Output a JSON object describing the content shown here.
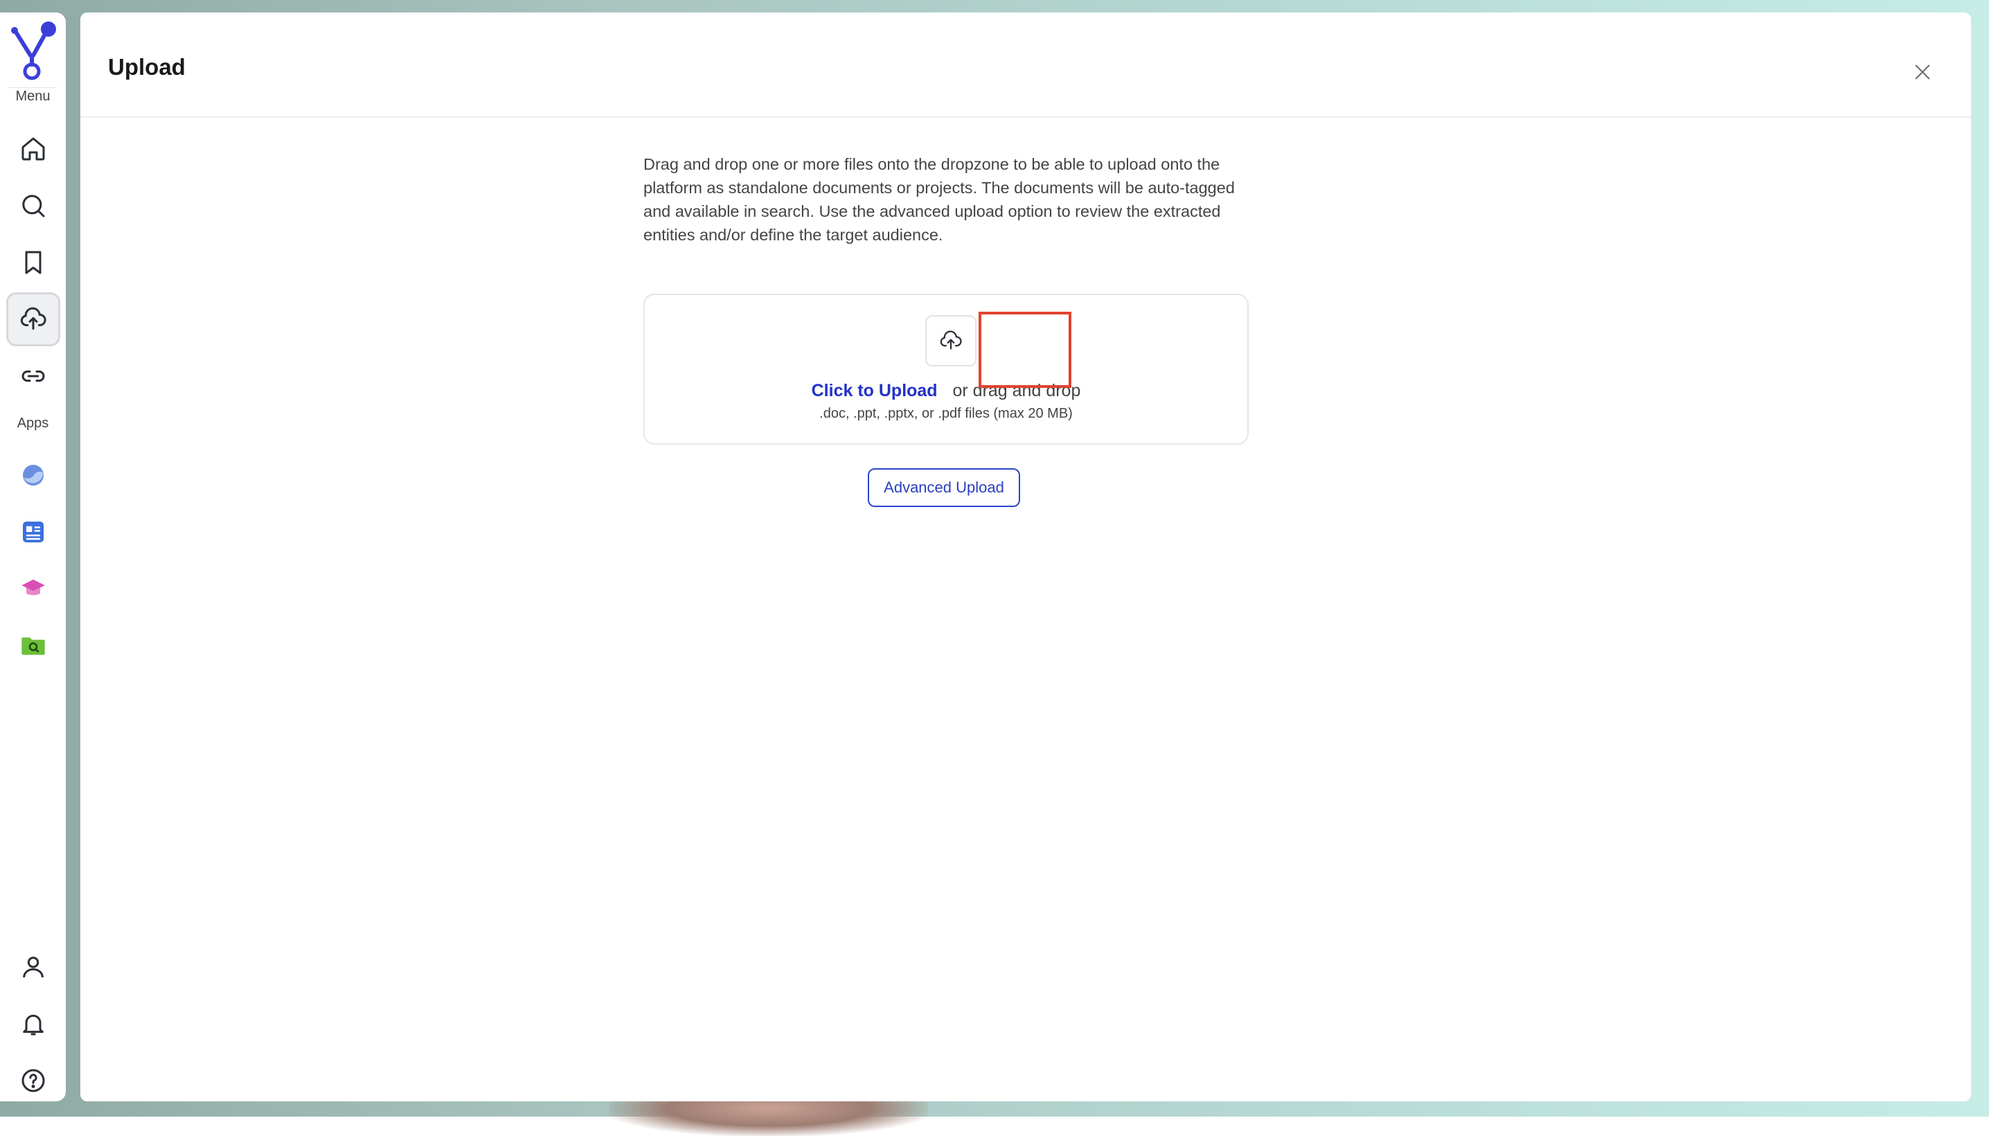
{
  "sidebar": {
    "menu_label": "Menu",
    "apps_label": "Apps",
    "menu_items": [
      {
        "icon": "home-icon",
        "active": false
      },
      {
        "icon": "search-icon",
        "active": false
      },
      {
        "icon": "bookmark-icon",
        "active": false
      },
      {
        "icon": "cloud-upload-icon",
        "active": true
      },
      {
        "icon": "link-icon",
        "active": false
      }
    ],
    "apps": [
      {
        "icon": "moon-app-icon",
        "color": "#6b8fe0"
      },
      {
        "icon": "document-app-icon",
        "color": "#3b6fe0"
      },
      {
        "icon": "graduation-cap-app-icon",
        "color": "#d94fb4"
      },
      {
        "icon": "folder-search-app-icon",
        "color": "#6cbf3a"
      }
    ],
    "bottom_items": [
      {
        "icon": "user-icon"
      },
      {
        "icon": "bell-icon"
      },
      {
        "icon": "help-icon"
      }
    ]
  },
  "panel": {
    "title": "Upload",
    "description": "Drag and drop one or more files onto the dropzone to be able to upload onto the platform as standalone documents or projects. The documents will be auto-tagged and available in search. Use the advanced upload option to review the extracted entities and/or define the target audience.",
    "dropzone": {
      "click_label": "Click to Upload",
      "drag_label": "or drag and drop",
      "hint": ".doc, .ppt, .pptx, or .pdf files (max 20 MB)"
    },
    "advanced_button": "Advanced Upload"
  },
  "colors": {
    "accent": "#2232c9",
    "highlight": "#e0432f"
  }
}
